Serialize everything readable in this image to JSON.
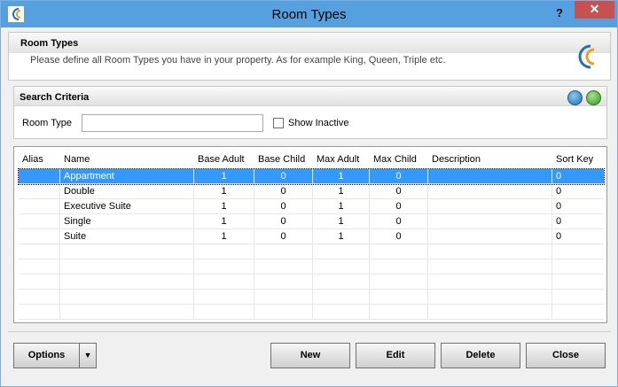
{
  "window": {
    "title": "Room Types",
    "help": "?",
    "close": "✕"
  },
  "header": {
    "title": "Room Types",
    "subtitle": "Please define all Room Types you have in your property. As for example King, Queen, Triple etc."
  },
  "search": {
    "title": "Search Criteria",
    "room_type_label": "Room Type",
    "room_type_value": "",
    "show_inactive_label": "Show Inactive",
    "show_inactive_checked": false
  },
  "grid": {
    "columns": [
      "Alias",
      "Name",
      "Base Adult",
      "Base Child",
      "Max Adult",
      "Max Child",
      "Description",
      "Sort Key"
    ],
    "rows": [
      {
        "alias": "",
        "name": "Appartment",
        "base_adult": "1",
        "base_child": "0",
        "max_adult": "1",
        "max_child": "0",
        "description": "",
        "sort_key": "0",
        "selected": true
      },
      {
        "alias": "",
        "name": "Double",
        "base_adult": "1",
        "base_child": "0",
        "max_adult": "1",
        "max_child": "0",
        "description": "",
        "sort_key": "0"
      },
      {
        "alias": "",
        "name": "Executive Suite",
        "base_adult": "1",
        "base_child": "0",
        "max_adult": "1",
        "max_child": "0",
        "description": "",
        "sort_key": "0"
      },
      {
        "alias": "",
        "name": "Single",
        "base_adult": "1",
        "base_child": "0",
        "max_adult": "1",
        "max_child": "0",
        "description": "",
        "sort_key": "0"
      },
      {
        "alias": "",
        "name": "Suite",
        "base_adult": "1",
        "base_child": "0",
        "max_adult": "1",
        "max_child": "0",
        "description": "",
        "sort_key": "0"
      }
    ],
    "empty_rows": 5
  },
  "buttons": {
    "options": "Options",
    "options_drop": "▼",
    "new": "New",
    "edit": "Edit",
    "delete": "Delete",
    "close": "Close"
  },
  "colors": {
    "titlebar": "#56a0e0",
    "selection": "#3399ff",
    "close": "#c75050"
  },
  "icons": {
    "app": "hotel-logo-icon",
    "search": "search-icon",
    "refresh": "refresh-icon"
  }
}
